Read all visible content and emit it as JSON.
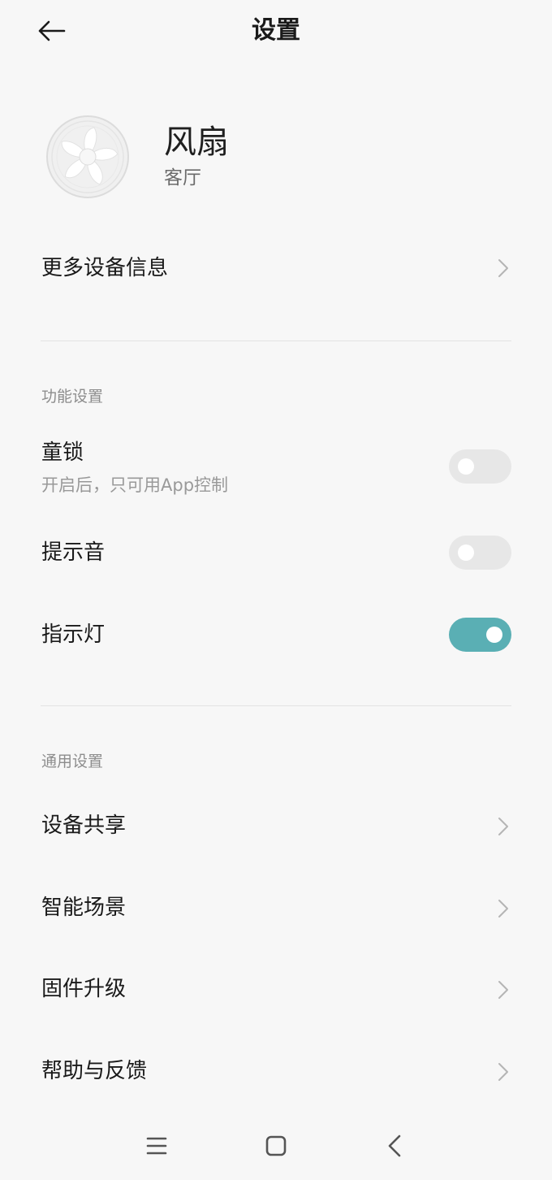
{
  "header": {
    "title": "设置",
    "back_icon": "arrow-left-icon"
  },
  "device": {
    "name": "风扇",
    "room": "客厅",
    "image_icon": "fan-icon"
  },
  "more_info": {
    "label": "更多设备信息"
  },
  "function_section": {
    "title": "功能设置",
    "items": [
      {
        "label": "童锁",
        "sublabel": "开启后，只可用App控制",
        "enabled": false
      },
      {
        "label": "提示音",
        "enabled": false
      },
      {
        "label": "指示灯",
        "enabled": true
      }
    ]
  },
  "general_section": {
    "title": "通用设置",
    "items": [
      {
        "label": "设备共享"
      },
      {
        "label": "智能场景"
      },
      {
        "label": "固件升级"
      },
      {
        "label": "帮助与反馈"
      }
    ]
  },
  "colors": {
    "toggle_on": "#5aafb4",
    "toggle_off": "#e7e7e7",
    "background": "#f7f7f7"
  },
  "navbar": {
    "icons": [
      "menu-icon",
      "home-icon",
      "back-icon"
    ]
  }
}
